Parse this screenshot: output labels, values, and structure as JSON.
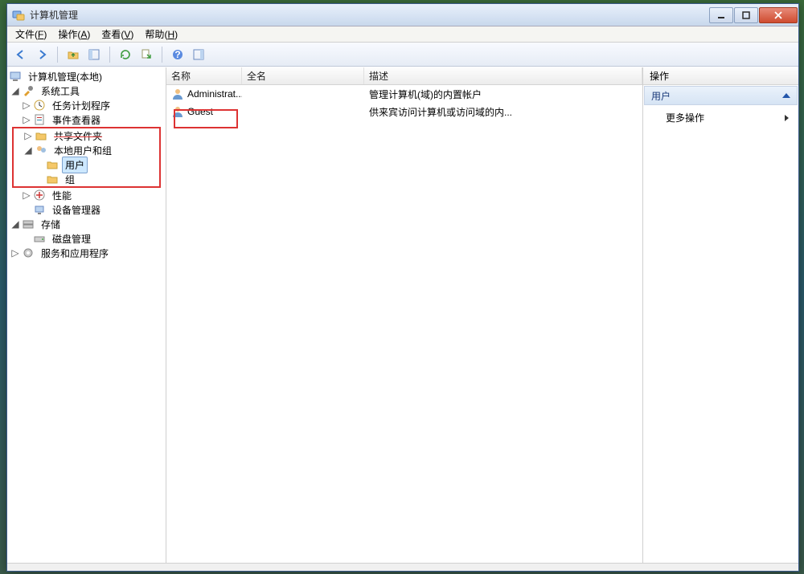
{
  "title": "计算机管理",
  "menubar": [
    {
      "label": "文件",
      "accel": "F"
    },
    {
      "label": "操作",
      "accel": "A"
    },
    {
      "label": "查看",
      "accel": "V"
    },
    {
      "label": "帮助",
      "accel": "H"
    }
  ],
  "tree": {
    "root": "计算机管理(本地)",
    "system_tools": "系统工具",
    "task_scheduler": "任务计划程序",
    "event_viewer": "事件查看器",
    "shared_folders": "共享文件夹",
    "local_users_groups": "本地用户和组",
    "users": "用户",
    "groups": "组",
    "performance": "性能",
    "device_manager": "设备管理器",
    "storage": "存储",
    "disk_management": "磁盘管理",
    "services_apps": "服务和应用程序"
  },
  "list": {
    "headers": {
      "name": "名称",
      "fullname": "全名",
      "desc": "描述"
    },
    "rows": [
      {
        "name": "Administrat...",
        "fullname": "",
        "desc": "管理计算机(域)的内置帐户"
      },
      {
        "name": "Guest",
        "fullname": "",
        "desc": "供来宾访问计算机或访问域的内..."
      }
    ]
  },
  "actions": {
    "header": "操作",
    "context": "用户",
    "more": "更多操作"
  }
}
